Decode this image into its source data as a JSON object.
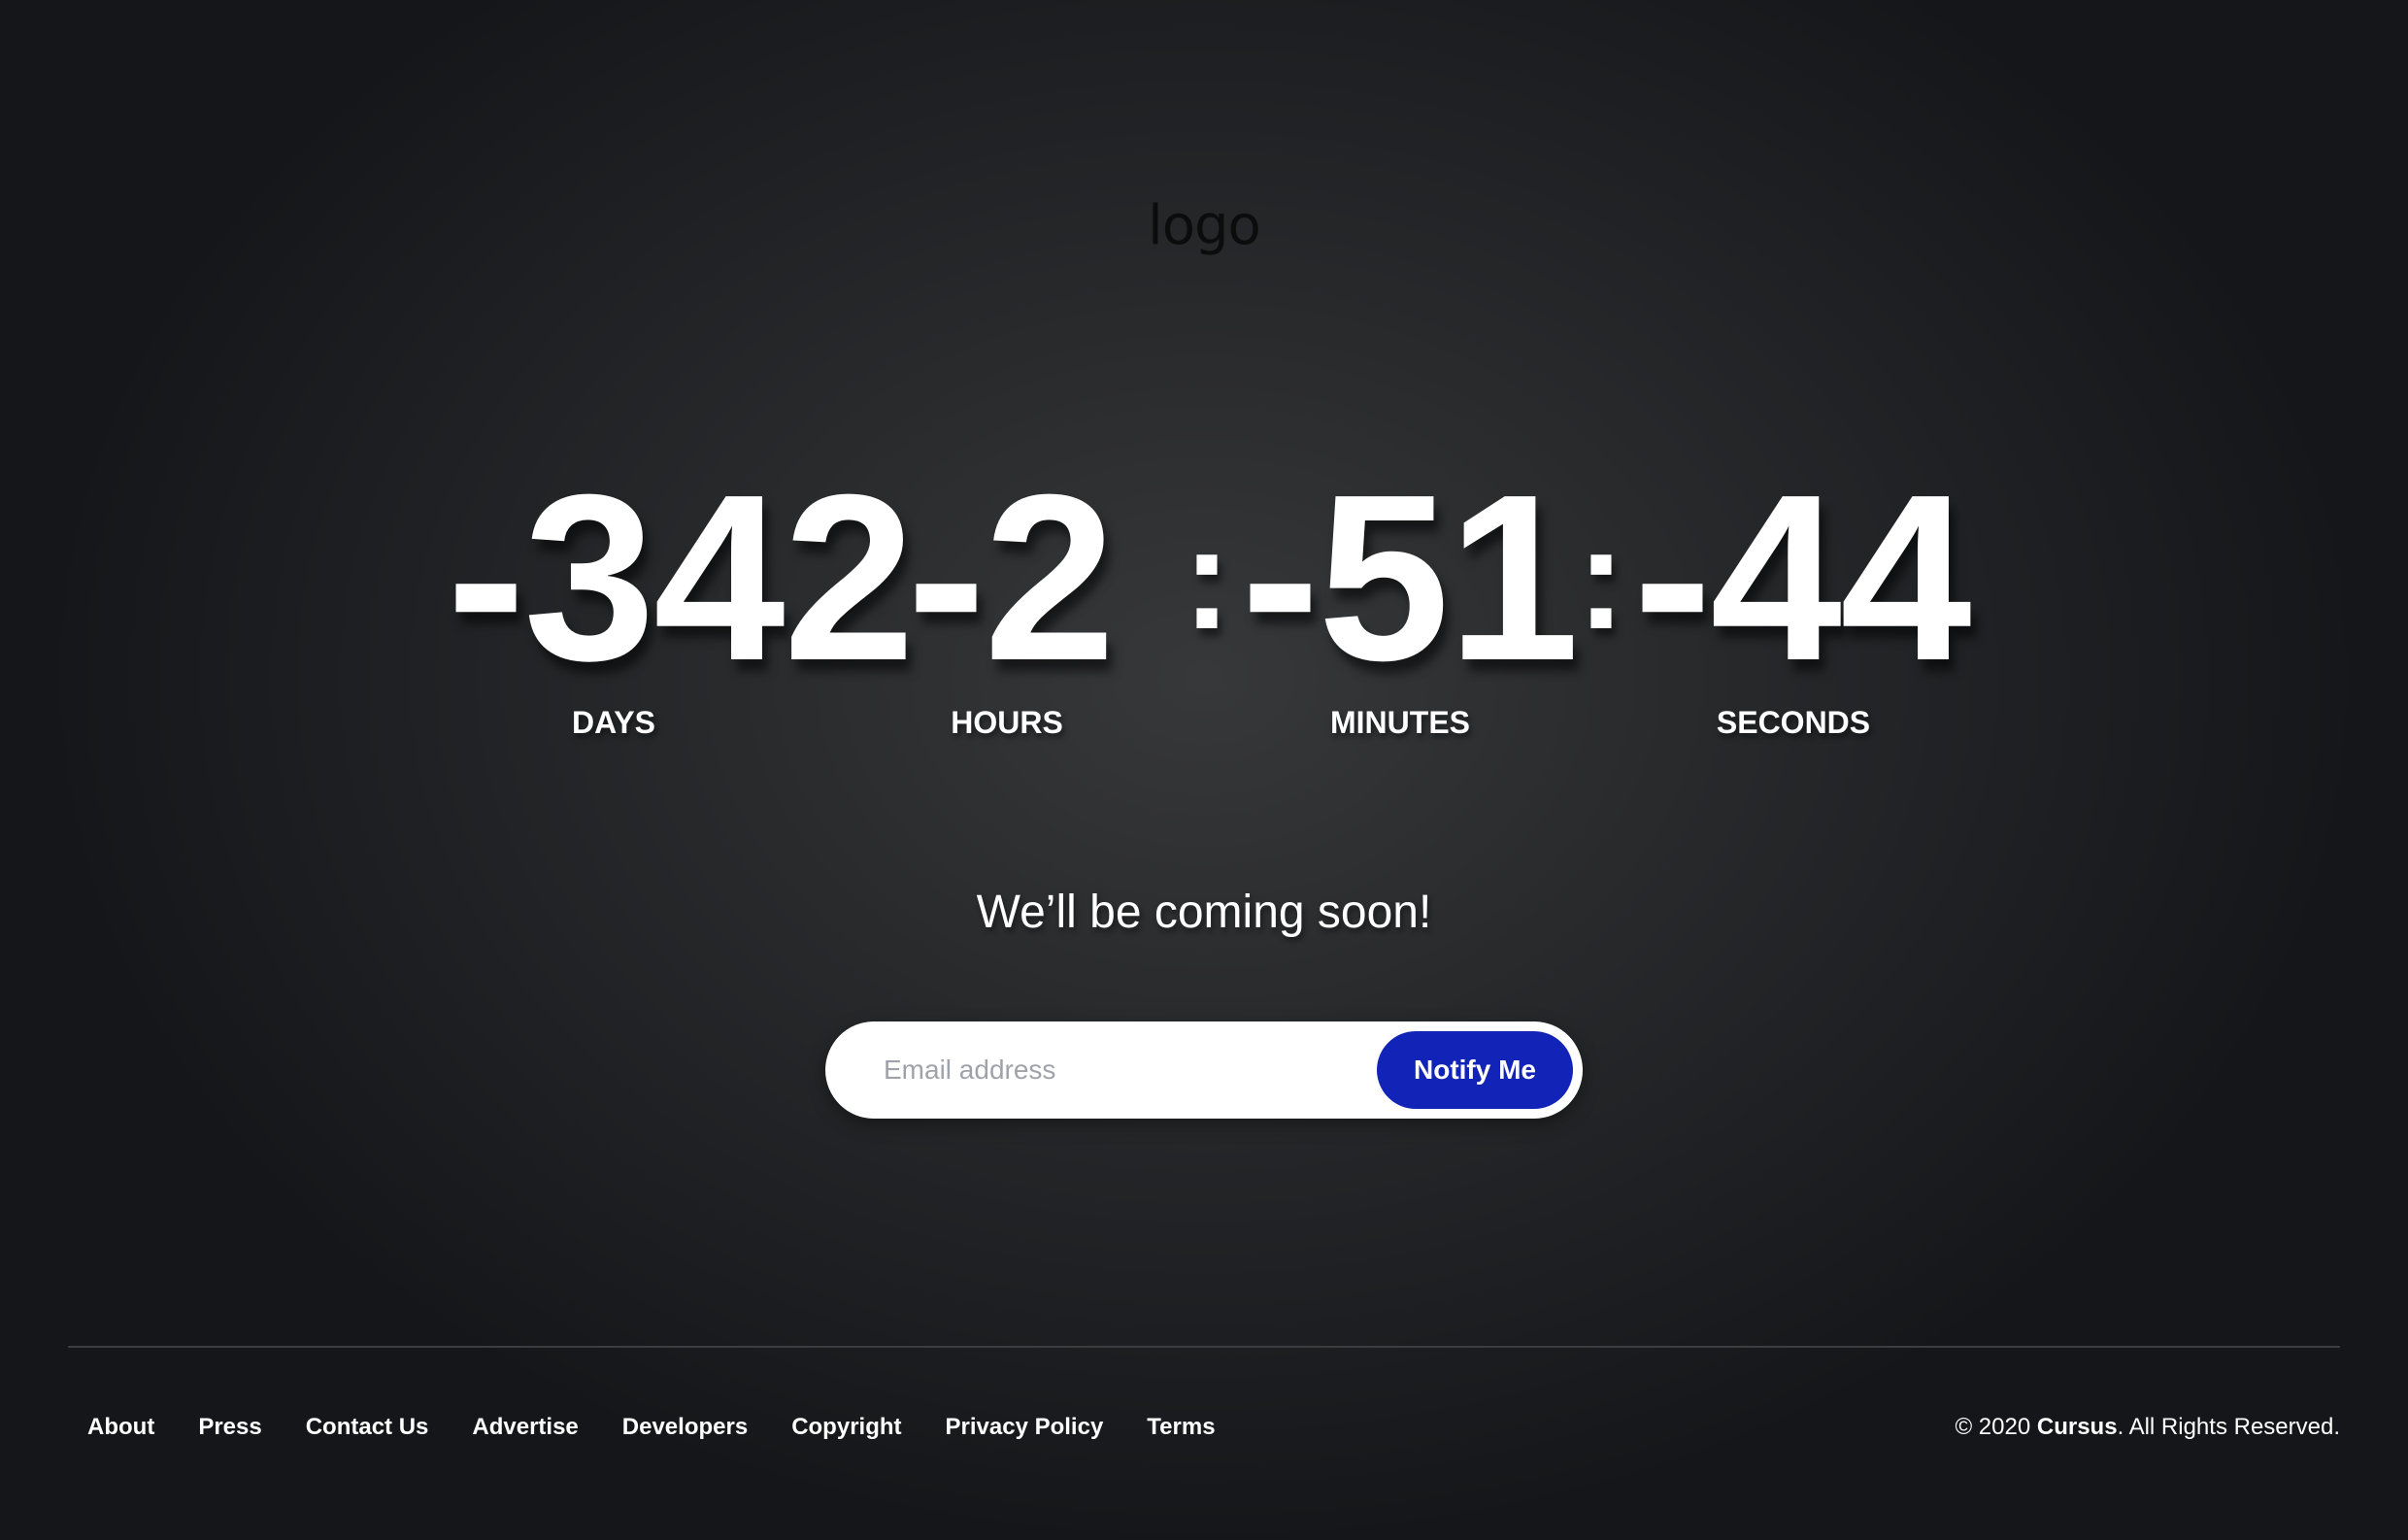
{
  "logo": {
    "text": "logo"
  },
  "countdown": {
    "days": "-342",
    "hours": "-2",
    "minutes": "-51",
    "seconds": "-44",
    "separator": ":",
    "labels": {
      "days": "DAYS",
      "hours": "HOURS",
      "minutes": "MINUTES",
      "seconds": "SECONDS"
    }
  },
  "tagline": "We’ll be coming soon!",
  "subscribe": {
    "placeholder": "Email address",
    "value": "",
    "button_label": "Notify Me",
    "button_color": "#1224b8"
  },
  "footer": {
    "links": [
      "About",
      "Press",
      "Contact Us",
      "Advertise",
      "Developers",
      "Copyright",
      "Privacy Policy",
      "Terms"
    ],
    "copyright_prefix": "© 2020 ",
    "copyright_brand": "Cursus",
    "copyright_suffix": ". All Rights Reserved."
  }
}
